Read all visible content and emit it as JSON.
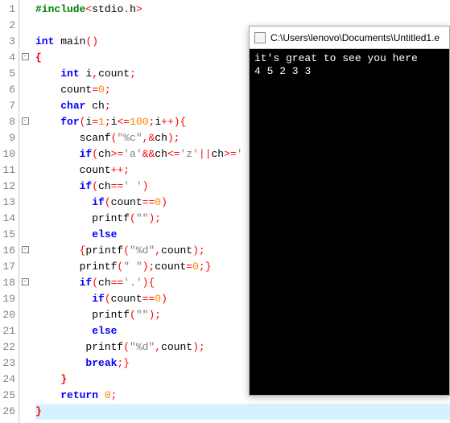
{
  "lines": [
    {
      "n": "1",
      "fold": "",
      "html": "<span class='pp'>#include</span><span class='op'>&lt;</span><span class='plain'>stdio</span><span class='op'>.</span><span class='plain'>h</span><span class='op'>&gt;</span>"
    },
    {
      "n": "2",
      "fold": "",
      "html": ""
    },
    {
      "n": "3",
      "fold": "",
      "html": "<span class='kw'>int</span> <span class='fn'>main</span><span class='op'>()</span>"
    },
    {
      "n": "4",
      "fold": "box",
      "html": "<span class='brace'>{</span>"
    },
    {
      "n": "5",
      "fold": "",
      "html": "    <span class='kw'>int</span> <span class='plain'>i</span><span class='op'>,</span><span class='plain'>count</span><span class='op'>;</span>"
    },
    {
      "n": "6",
      "fold": "",
      "html": "    <span class='plain'>count</span><span class='op'>=</span><span class='num'>0</span><span class='op'>;</span>"
    },
    {
      "n": "7",
      "fold": "",
      "html": "    <span class='kw'>char</span> <span class='plain'>ch</span><span class='op'>;</span>"
    },
    {
      "n": "8",
      "fold": "box",
      "html": "    <span class='kw'>for</span><span class='op'>(</span><span class='plain'>i</span><span class='op'>=</span><span class='num'>1</span><span class='op'>;</span><span class='plain'>i</span><span class='op'>&lt;=</span><span class='num'>100</span><span class='op'>;</span><span class='plain'>i</span><span class='op'>++){</span>"
    },
    {
      "n": "9",
      "fold": "",
      "html": "       <span class='plain'>scanf</span><span class='op'>(</span><span class='str'>\"%c\"</span><span class='op'>,&amp;</span><span class='plain'>ch</span><span class='op'>);</span>"
    },
    {
      "n": "10",
      "fold": "",
      "html": "       <span class='kw'>if</span><span class='op'>(</span><span class='plain'>ch</span><span class='op'>&gt;=</span><span class='str'>'a'</span><span class='op'>&amp;&amp;</span><span class='plain'>ch</span><span class='op'>&lt;=</span><span class='str'>'z'</span><span class='op'>||</span><span class='plain'>ch</span><span class='op'>&gt;=</span><span class='str'>'</span>"
    },
    {
      "n": "11",
      "fold": "",
      "html": "       <span class='plain'>count</span><span class='op'>++;</span>"
    },
    {
      "n": "12",
      "fold": "",
      "html": "       <span class='kw'>if</span><span class='op'>(</span><span class='plain'>ch</span><span class='op'>==</span><span class='str'>' '</span><span class='op'>)</span>"
    },
    {
      "n": "13",
      "fold": "",
      "html": "         <span class='kw'>if</span><span class='op'>(</span><span class='plain'>count</span><span class='op'>==</span><span class='num'>0</span><span class='op'>)</span>"
    },
    {
      "n": "14",
      "fold": "",
      "html": "         <span class='plain'>printf</span><span class='op'>(</span><span class='str'>\"\"</span><span class='op'>);</span>"
    },
    {
      "n": "15",
      "fold": "",
      "html": "         <span class='kw'>else</span>"
    },
    {
      "n": "16",
      "fold": "box",
      "html": "       <span class='op'>{</span><span class='plain'>printf</span><span class='op'>(</span><span class='str'>\"%d\"</span><span class='op'>,</span><span class='plain'>count</span><span class='op'>);</span>"
    },
    {
      "n": "17",
      "fold": "",
      "html": "       <span class='plain'>printf</span><span class='op'>(</span><span class='str'>\" \"</span><span class='op'>);</span><span class='plain'>count</span><span class='op'>=</span><span class='num'>0</span><span class='op'>;}</span>"
    },
    {
      "n": "18",
      "fold": "box",
      "html": "       <span class='kw'>if</span><span class='op'>(</span><span class='plain'>ch</span><span class='op'>==</span><span class='str'>'.'</span><span class='op'>){</span>"
    },
    {
      "n": "19",
      "fold": "",
      "html": "         <span class='kw'>if</span><span class='op'>(</span><span class='plain'>count</span><span class='op'>==</span><span class='num'>0</span><span class='op'>)</span>"
    },
    {
      "n": "20",
      "fold": "",
      "html": "         <span class='plain'>printf</span><span class='op'>(</span><span class='str'>\"\"</span><span class='op'>);</span>"
    },
    {
      "n": "21",
      "fold": "",
      "html": "         <span class='kw'>else</span>"
    },
    {
      "n": "22",
      "fold": "",
      "html": "        <span class='plain'>printf</span><span class='op'>(</span><span class='str'>\"%d\"</span><span class='op'>,</span><span class='plain'>count</span><span class='op'>);</span>"
    },
    {
      "n": "23",
      "fold": "",
      "html": "        <span class='kw'>break</span><span class='op'>;}</span>"
    },
    {
      "n": "24",
      "fold": "",
      "html": "    <span class='brace'>}</span>"
    },
    {
      "n": "25",
      "fold": "",
      "html": "    <span class='kw'>return</span> <span class='num'>0</span><span class='op'>;</span>"
    },
    {
      "n": "26",
      "fold": "",
      "html": "<span class='brace'>}</span>",
      "cursor": true
    }
  ],
  "console": {
    "title": "C:\\Users\\lenovo\\Documents\\Untitled1.e",
    "out_line1": "it's great to see you here",
    "out_line2": "4 5 2 3 3"
  }
}
